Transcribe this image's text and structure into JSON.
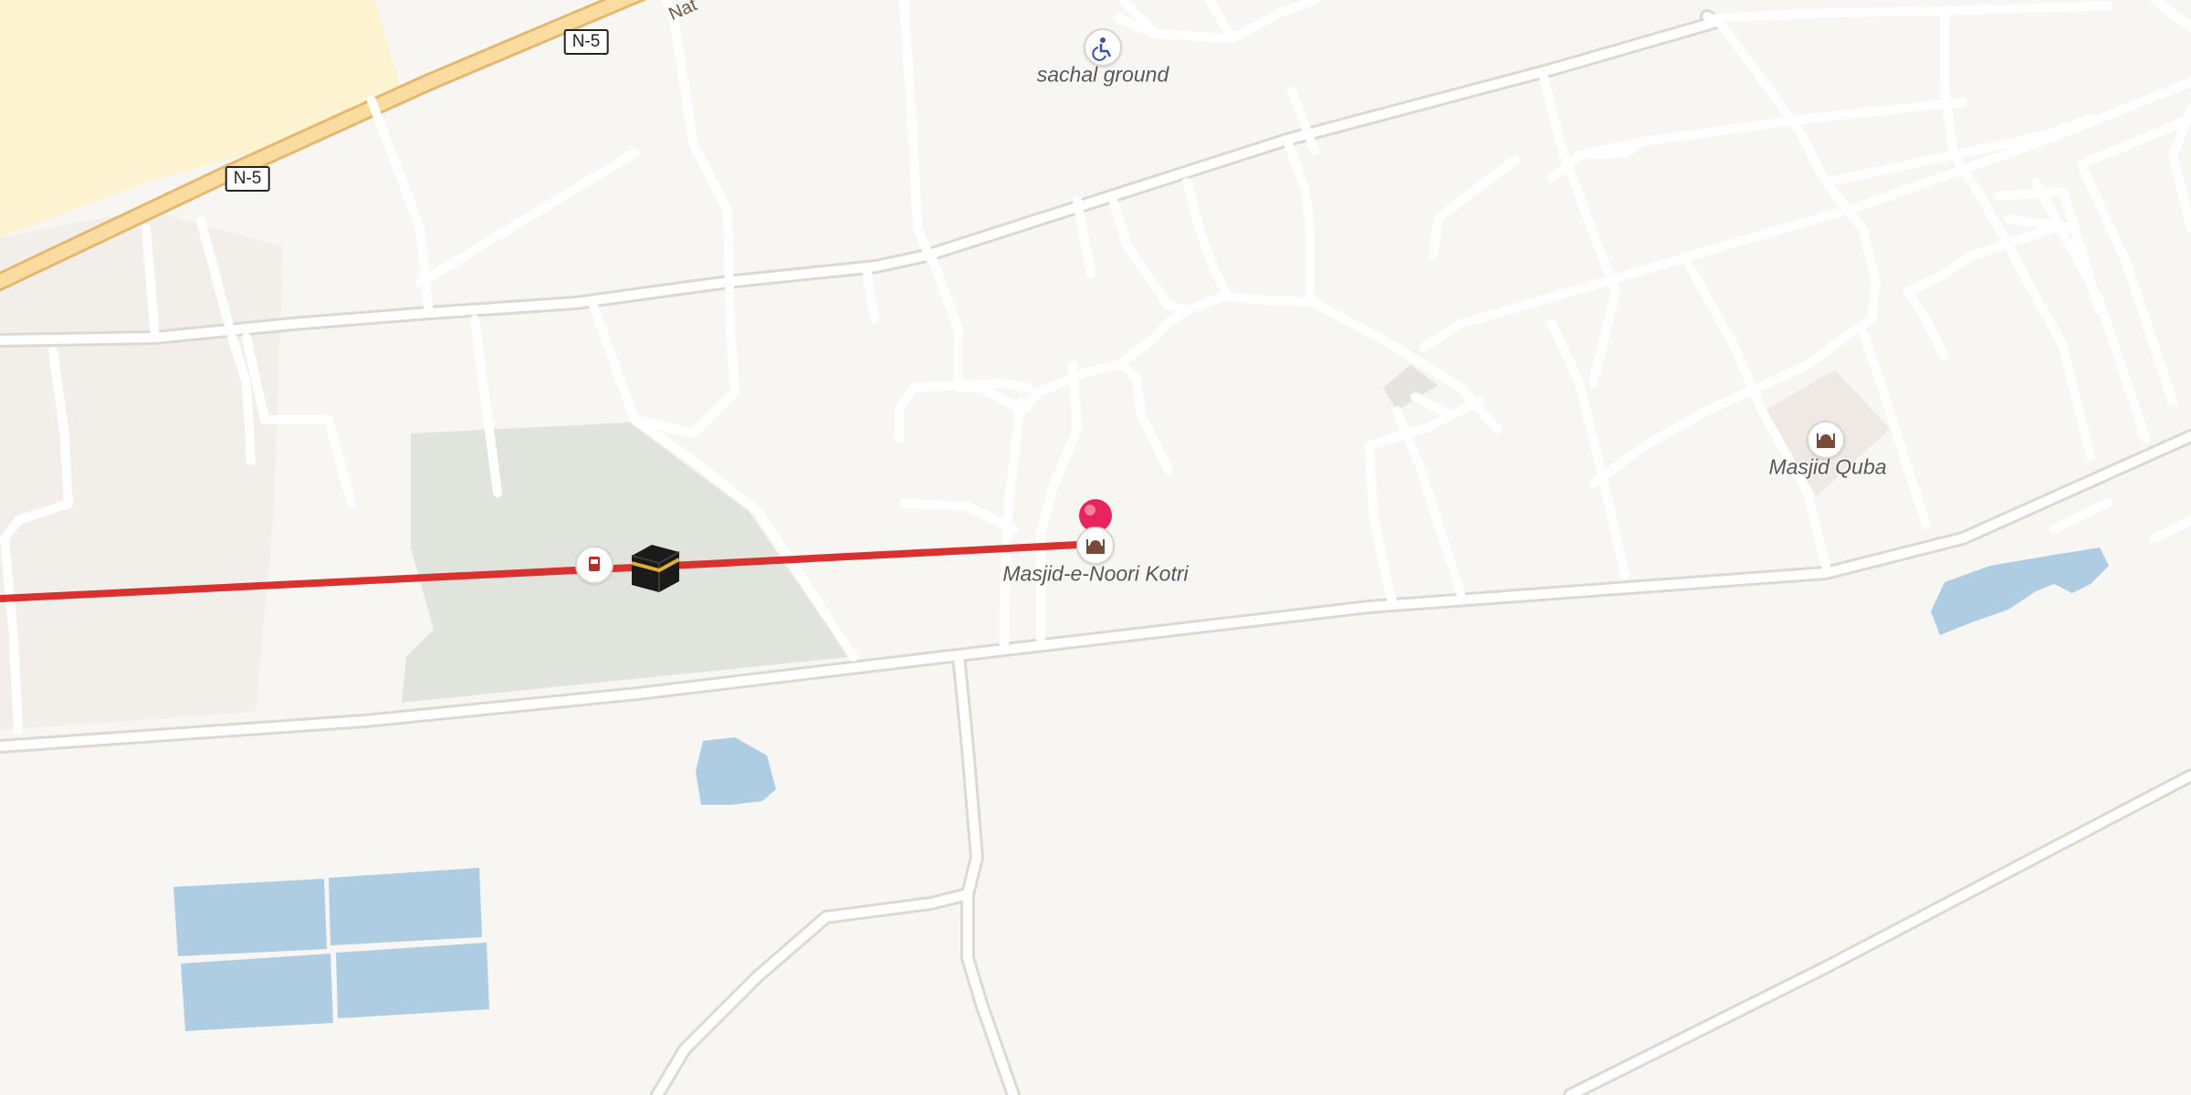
{
  "map": {
    "colors": {
      "land": "#f8f6f3",
      "road": "#ffffff",
      "road_casing": "#dcd8d2",
      "highway_fill": "#fbdca0",
      "highway_casing": "#e4b870",
      "water": "#aecde3",
      "park": "#e0e4dc",
      "urban_yellow": "#fdf3d0",
      "route": "#d93030",
      "marker": "#e8245c"
    },
    "labels": {
      "sachal_ground": "sachal ground",
      "masjid_noori": "Masjid-e-Noori Kotri",
      "masjid_quba": "Masjid Quba"
    },
    "road_name": "Nat",
    "shields": [
      "N-5",
      "N-5"
    ],
    "icons": {
      "sachal_ground": "wheelchair-sports-icon",
      "masjid_noori": "mosque-icon",
      "masjid_quba": "mosque-icon",
      "route_start": "bus-stop-icon",
      "kaaba": "kaaba-icon",
      "destination": "location-pin-icon"
    }
  }
}
